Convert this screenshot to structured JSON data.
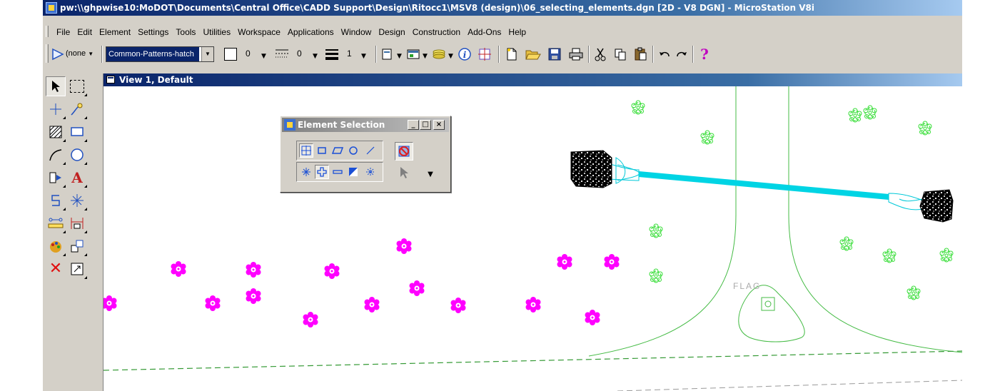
{
  "window": {
    "title": "pw:\\\\ghpwise10:MoDOT\\Documents\\Central Office\\CADD Support\\Design\\Ritocc1\\MSV8 (design)\\06_selecting_elements.dgn [2D - V8 DGN] - MicroStation V8i"
  },
  "menu": {
    "items": [
      "File",
      "Edit",
      "Element",
      "Settings",
      "Tools",
      "Utilities",
      "Workspace",
      "Applications",
      "Window",
      "Design",
      "Construction",
      "Add-Ons",
      "Help"
    ]
  },
  "toolbar": {
    "level_value": "(none",
    "level_dd": "▼",
    "style_value": "Common-Patterns-hatch",
    "color_value": "0",
    "linestyle_value": "0",
    "weight_value": "1",
    "help_glyph": "?"
  },
  "view": {
    "title": "View 1, Default",
    "flag_label": "FLAG"
  },
  "element_selection": {
    "title": "Element Selection",
    "min_glyph": "_",
    "max_glyph": "□",
    "close_glyph": "×"
  },
  "colors": {
    "title_bar": "#0a246a",
    "chrome": "#d4d0c8",
    "trees_magenta": "#ff00ff",
    "shrubs_green": "#33dd33",
    "pipe_cyan": "#00d4e4",
    "road_green": "#44bb44"
  }
}
